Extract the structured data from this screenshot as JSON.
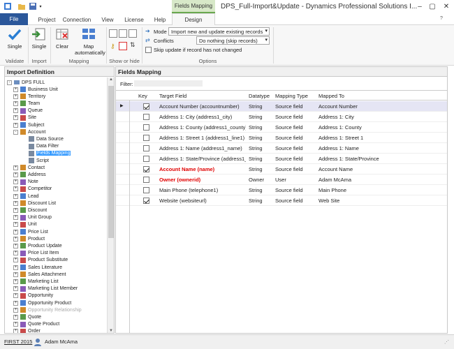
{
  "window": {
    "title": "DPS_Full-Import&Update - Dynamics Professional Solutions I...",
    "context_tab": "Fields Mapping"
  },
  "tabs": [
    "File",
    "Project",
    "Connection",
    "View",
    "License",
    "Help",
    "Design"
  ],
  "ribbon": {
    "validate": {
      "single": "Single",
      "group": "Validate"
    },
    "import": {
      "single": "Single",
      "group": "Import"
    },
    "mapping": {
      "clear": "Clear",
      "map_auto": "Map automatically",
      "group": "Mapping"
    },
    "show_hide": {
      "group": "Show or hide"
    },
    "options": {
      "mode_label": "Mode",
      "mode_value": "Import new and update existing records",
      "conflicts_label": "Conflicts",
      "conflicts_value": "Do nothing (skip records)",
      "skip_label": "Skip update if record has not changed",
      "group": "Options"
    }
  },
  "import_definition": {
    "title": "Import Definition",
    "root": "DPS FULL",
    "items": [
      {
        "label": "Business Unit",
        "depth": 1,
        "expander": "+",
        "disabled": false,
        "selected": false
      },
      {
        "label": "Territory",
        "depth": 1,
        "expander": "+",
        "disabled": false,
        "selected": false
      },
      {
        "label": "Team",
        "depth": 1,
        "expander": "+",
        "disabled": false,
        "selected": false
      },
      {
        "label": "Queue",
        "depth": 1,
        "expander": "+",
        "disabled": false,
        "selected": false
      },
      {
        "label": "Site",
        "depth": 1,
        "expander": "+",
        "disabled": false,
        "selected": false
      },
      {
        "label": "Subject",
        "depth": 1,
        "expander": "+",
        "disabled": false,
        "selected": false
      },
      {
        "label": "Account",
        "depth": 1,
        "expander": "-",
        "disabled": false,
        "selected": false
      },
      {
        "label": "Data Source",
        "depth": 2,
        "expander": "",
        "disabled": false,
        "selected": false
      },
      {
        "label": "Data Filter",
        "depth": 2,
        "expander": "",
        "disabled": false,
        "selected": false
      },
      {
        "label": "Fields Mapping",
        "depth": 2,
        "expander": "",
        "disabled": false,
        "selected": true
      },
      {
        "label": "Script",
        "depth": 2,
        "expander": "",
        "disabled": false,
        "selected": false
      },
      {
        "label": "Contact",
        "depth": 1,
        "expander": "+",
        "disabled": false,
        "selected": false
      },
      {
        "label": "Address",
        "depth": 1,
        "expander": "+",
        "disabled": false,
        "selected": false
      },
      {
        "label": "Note",
        "depth": 1,
        "expander": "+",
        "disabled": false,
        "selected": false
      },
      {
        "label": "Competitor",
        "depth": 1,
        "expander": "+",
        "disabled": false,
        "selected": false
      },
      {
        "label": "Lead",
        "depth": 1,
        "expander": "+",
        "disabled": false,
        "selected": false
      },
      {
        "label": "Discount List",
        "depth": 1,
        "expander": "+",
        "disabled": false,
        "selected": false
      },
      {
        "label": "Discount",
        "depth": 1,
        "expander": "+",
        "disabled": false,
        "selected": false
      },
      {
        "label": "Unit Group",
        "depth": 1,
        "expander": "+",
        "disabled": false,
        "selected": false
      },
      {
        "label": "Unit",
        "depth": 1,
        "expander": "+",
        "disabled": false,
        "selected": false
      },
      {
        "label": "Price List",
        "depth": 1,
        "expander": "+",
        "disabled": false,
        "selected": false
      },
      {
        "label": "Product",
        "depth": 1,
        "expander": "+",
        "disabled": false,
        "selected": false
      },
      {
        "label": "Product Update",
        "depth": 1,
        "expander": "+",
        "disabled": false,
        "selected": false
      },
      {
        "label": "Price List Item",
        "depth": 1,
        "expander": "+",
        "disabled": false,
        "selected": false
      },
      {
        "label": "Product Substitute",
        "depth": 1,
        "expander": "+",
        "disabled": false,
        "selected": false
      },
      {
        "label": "Sales Literature",
        "depth": 1,
        "expander": "+",
        "disabled": false,
        "selected": false
      },
      {
        "label": "Sales Attachment",
        "depth": 1,
        "expander": "+",
        "disabled": false,
        "selected": false
      },
      {
        "label": "Marketing List",
        "depth": 1,
        "expander": "+",
        "disabled": false,
        "selected": false
      },
      {
        "label": "Marketing List Member",
        "depth": 1,
        "expander": "+",
        "disabled": false,
        "selected": false
      },
      {
        "label": "Opportunity",
        "depth": 1,
        "expander": "+",
        "disabled": false,
        "selected": false
      },
      {
        "label": "Opportunity Product",
        "depth": 1,
        "expander": "+",
        "disabled": false,
        "selected": false
      },
      {
        "label": "Opportunity Relationship",
        "depth": 1,
        "expander": "+",
        "disabled": true,
        "selected": false
      },
      {
        "label": "Quote",
        "depth": 1,
        "expander": "+",
        "disabled": false,
        "selected": false
      },
      {
        "label": "Quote Product",
        "depth": 1,
        "expander": "+",
        "disabled": false,
        "selected": false
      },
      {
        "label": "Order",
        "depth": 1,
        "expander": "+",
        "disabled": false,
        "selected": false
      }
    ]
  },
  "fields_mapping": {
    "title": "Fields Mapping",
    "filter_label": "Filter:",
    "filter_value": "",
    "columns": [
      "Key",
      "Target Field",
      "Datatype",
      "Mapping Type",
      "Mapped To"
    ],
    "rows": [
      {
        "key": true,
        "target": "Account Number (accountnumber)",
        "datatype": "String",
        "mapping": "Source field",
        "mapped_to": "Account Number",
        "required": false,
        "selected": true
      },
      {
        "key": false,
        "target": "Address 1: City (address1_city)",
        "datatype": "String",
        "mapping": "Source field",
        "mapped_to": "Address 1: City",
        "required": false,
        "selected": false
      },
      {
        "key": false,
        "target": "Address 1: County (address1_county)",
        "datatype": "String",
        "mapping": "Source field",
        "mapped_to": "Address 1: County",
        "required": false,
        "selected": false
      },
      {
        "key": false,
        "target": "Address 1: Street 1 (address1_line1)",
        "datatype": "String",
        "mapping": "Source field",
        "mapped_to": "Address 1: Street 1",
        "required": false,
        "selected": false
      },
      {
        "key": false,
        "target": "Address 1: Name (address1_name)",
        "datatype": "String",
        "mapping": "Source field",
        "mapped_to": "Address 1: Name",
        "required": false,
        "selected": false
      },
      {
        "key": false,
        "target": "Address 1: State/Province (address1_...",
        "datatype": "String",
        "mapping": "Source field",
        "mapped_to": "Address 1: State/Province",
        "required": false,
        "selected": false
      },
      {
        "key": true,
        "target": "Account Name (name)",
        "datatype": "String",
        "mapping": "Source field",
        "mapped_to": "Account Name",
        "required": true,
        "selected": false
      },
      {
        "key": false,
        "target": "Owner (ownerid)",
        "datatype": "Owner",
        "mapping": "User",
        "mapped_to": "Adam McAma",
        "required": true,
        "selected": false
      },
      {
        "key": false,
        "target": "Main Phone (telephone1)",
        "datatype": "String",
        "mapping": "Source field",
        "mapped_to": "Main Phone",
        "required": false,
        "selected": false
      },
      {
        "key": true,
        "target": "Website (websiteurl)",
        "datatype": "String",
        "mapping": "Source field",
        "mapped_to": "Web Site",
        "required": false,
        "selected": false
      }
    ]
  },
  "status": {
    "app": "FIRST 2015",
    "user": "Adam McAma"
  },
  "colors": {
    "file_tab": "#2b579a",
    "context_tab": "#d7e8c8",
    "selection": "#3399ff",
    "required": "#e00000"
  }
}
